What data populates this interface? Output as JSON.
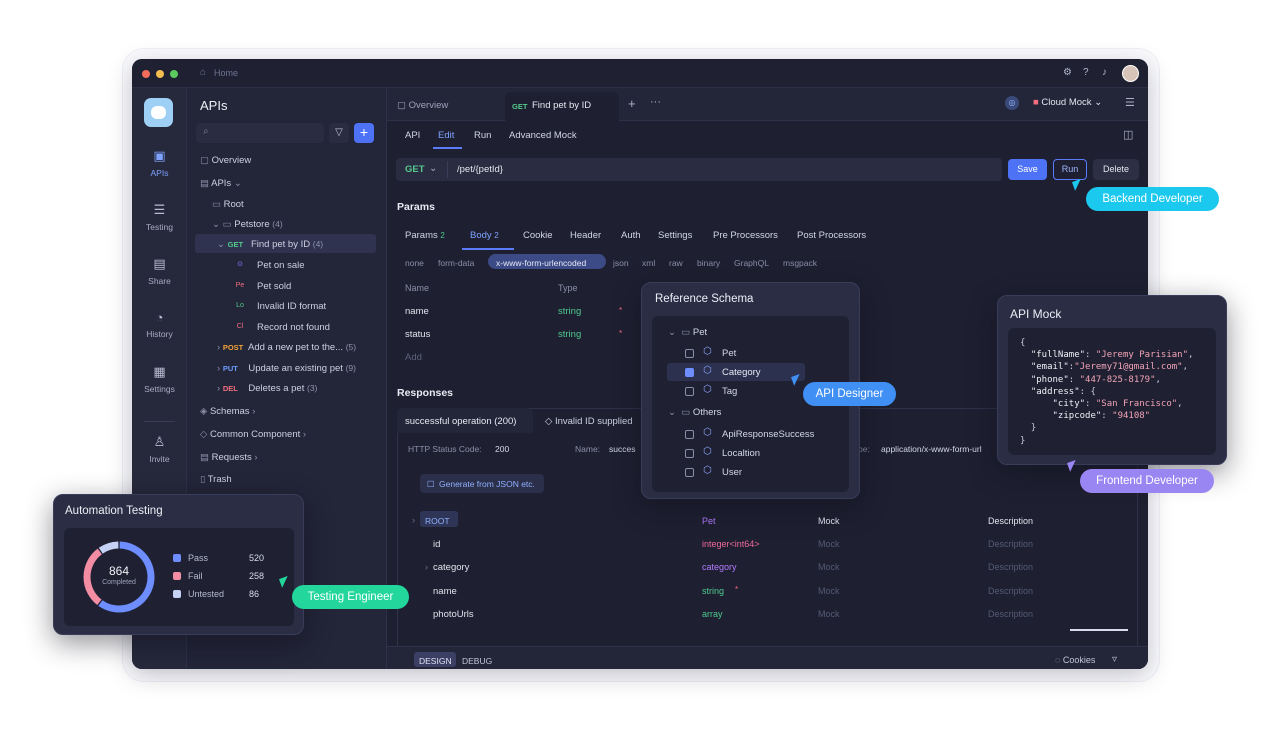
{
  "titlebar": {
    "home_label": "Home"
  },
  "rail": {
    "items": [
      {
        "label": "APIs",
        "icon": "api-icon"
      },
      {
        "label": "Testing",
        "icon": "testing-icon"
      },
      {
        "label": "Share",
        "icon": "share-icon"
      },
      {
        "label": "History",
        "icon": "history-icon"
      },
      {
        "label": "Settings",
        "icon": "settings-icon"
      },
      {
        "label": "Invite",
        "icon": "invite-icon"
      }
    ]
  },
  "sidebar": {
    "title": "APIs",
    "overview": "Overview",
    "apis": "APIs",
    "root": "Root",
    "petstore": "Petstore",
    "petstore_count": "(4)",
    "find_pet": {
      "method": "GET",
      "label": "Find pet by ID",
      "count": "(4)"
    },
    "cases": [
      {
        "chip": "⊙",
        "label": "Pet on sale",
        "color": "#7d8bff"
      },
      {
        "chip": "Pe",
        "label": "Pet sold",
        "color": "#f26d7d"
      },
      {
        "chip": "Lo",
        "label": "Invalid ID format",
        "color": "#55c98d"
      },
      {
        "chip": "Cl",
        "label": "Record not found",
        "color": "#f26d7d"
      }
    ],
    "endpoints": [
      {
        "method": "POST",
        "label": "Add a new pet to the...",
        "count": "(5)"
      },
      {
        "method": "PUT",
        "label": "Update an existing pet",
        "count": "(9)"
      },
      {
        "method": "DEL",
        "label": "Deletes a pet",
        "count": "(3)"
      }
    ],
    "schemas": "Schemas",
    "common": "Common Component",
    "requests": "Requests",
    "trash": "Trash"
  },
  "tabs": {
    "overview": "Overview",
    "active_method": "GET",
    "active_label": "Find pet by ID",
    "cloud_mock": "Cloud Mock"
  },
  "subtabs": [
    "API",
    "Edit",
    "Run",
    "Advanced Mock"
  ],
  "request": {
    "method": "GET",
    "path": "/pet/{petId}",
    "save": "Save",
    "run": "Run",
    "delete": "Delete"
  },
  "params": {
    "heading": "Params",
    "tabs": [
      "Params",
      "Body",
      "Cookie",
      "Header",
      "Auth",
      "Settings",
      "Pre Processors",
      "Post Processors"
    ],
    "params_count": "2",
    "body_count": "2",
    "body_types": [
      "none",
      "form-data",
      "x-www-form-urlencoded",
      "json",
      "xml",
      "raw",
      "binary",
      "GraphQL",
      "msgpack"
    ],
    "col_name": "Name",
    "col_type": "Type",
    "rows": [
      {
        "name": "name",
        "type": "string"
      },
      {
        "name": "status",
        "type": "string"
      }
    ],
    "add": "Add"
  },
  "responses": {
    "heading": "Responses",
    "tab_success": "successful operation (200)",
    "tab_invalid": "Invalid ID supplied",
    "status_label": "HTTP Status Code:",
    "status_value": "200",
    "name_label": "Name:",
    "name_value": "succes",
    "type_label": "pe:",
    "type_value": "application/x-www-form-url",
    "generate": "Generate from JSON etc.",
    "table": {
      "root": "ROOT",
      "root_type": "Pet",
      "mock_head": "Mock",
      "desc_head": "Description",
      "rows": [
        {
          "name": "id",
          "type": "integer<int64>",
          "mock": "Mock",
          "desc": "Description"
        },
        {
          "name": "category",
          "type": "category",
          "mock": "Mock",
          "desc": "Description"
        },
        {
          "name": "name",
          "type": "string",
          "mock": "Mock",
          "desc": "Description"
        },
        {
          "name": "photoUrls",
          "type": "array",
          "mock": "Mock",
          "desc": "Description"
        }
      ]
    }
  },
  "footer": {
    "design": "DESIGN",
    "debug": "DEBUG",
    "cookies": "Cookies"
  },
  "schema_panel": {
    "title": "Reference Schema",
    "pet_folder": "Pet",
    "pet_items": [
      {
        "label": "Pet",
        "checked": false
      },
      {
        "label": "Category",
        "checked": true
      },
      {
        "label": "Tag",
        "checked": false
      }
    ],
    "others_folder": "Others",
    "other_items": [
      {
        "label": "ApiResponseSuccess"
      },
      {
        "label": "Localtion"
      },
      {
        "label": "User"
      }
    ]
  },
  "mock_panel": {
    "title": "API Mock",
    "json": {
      "fullName": "Jeremy Parisian",
      "email": "Jeremy71@gmail.com",
      "phone": "447-825-8179",
      "city": "San Francisco",
      "zipcode": "94108"
    }
  },
  "automation": {
    "title": "Automation Testing",
    "total": "864",
    "total_label": "Completed",
    "chart_data": {
      "type": "pie",
      "categories": [
        "Pass",
        "Fail",
        "Untested"
      ],
      "values": [
        520,
        258,
        86
      ],
      "colors": [
        "#6e8dff",
        "#f28da3",
        "#c6d1f6"
      ]
    }
  },
  "badges": {
    "backend": "Backend Developer",
    "designer": "API Designer",
    "frontend": "Frontend Developer",
    "testing": "Testing Engineer"
  },
  "colors": {
    "accent": "#5b7cfa",
    "backend": "#1cc9ee",
    "designer": "#3f8ff5",
    "frontend": "#9a86f2",
    "testing": "#22d69c"
  }
}
